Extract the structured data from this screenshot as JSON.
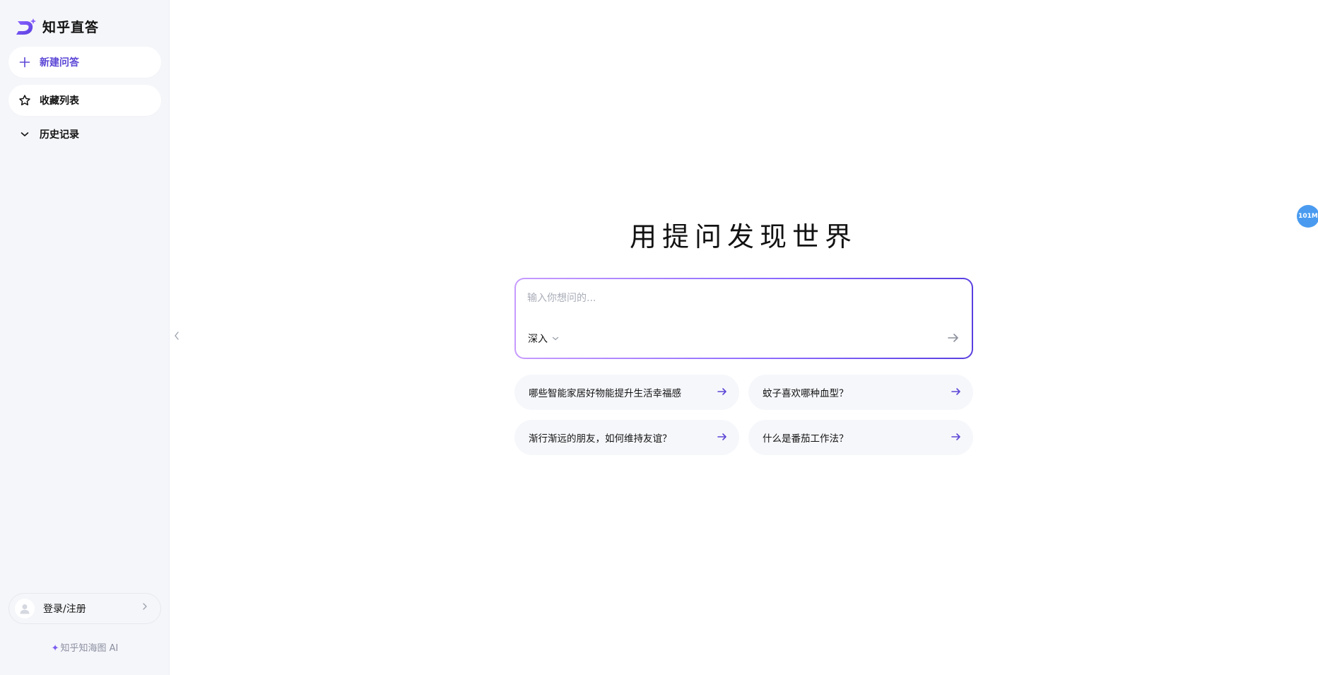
{
  "app": {
    "name": "知乎直答"
  },
  "colors": {
    "accent": "#5b47d6",
    "sidebar_bg": "#f5f6fa",
    "badge": "#4a9bf0"
  },
  "sidebar": {
    "new_chat_label": "新建问答",
    "favorites_label": "收藏列表",
    "history_label": "历史记录",
    "login_label": "登录/注册",
    "footer_brand": "知乎知海图 AI"
  },
  "main": {
    "headline": "用提问发现世界",
    "input": {
      "placeholder": "输入你想问的...",
      "value": ""
    },
    "mode": {
      "selected": "深入"
    },
    "suggestions": [
      "哪些智能家居好物能提升生活幸福感",
      "蚊子喜欢哪种血型？",
      "渐行渐远的朋友，如何维持友谊？",
      "什么是番茄工作法？"
    ]
  },
  "badge": {
    "text": "101M"
  }
}
